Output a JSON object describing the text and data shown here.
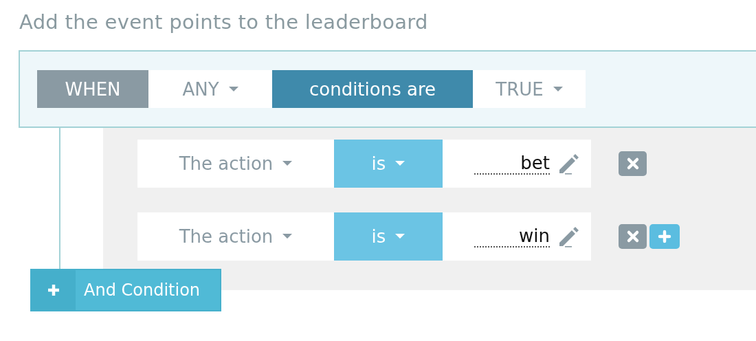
{
  "title": "Add the event points to the leaderboard",
  "when": {
    "label": "WHEN",
    "quantifier": "ANY",
    "middle": "conditions are",
    "truth": "TRUE"
  },
  "conditions": [
    {
      "field": "The action",
      "operator": "is",
      "value": "bet",
      "can_add": false
    },
    {
      "field": "The action",
      "operator": "is",
      "value": "win",
      "can_add": true
    }
  ],
  "add_button": {
    "label": "And Condition"
  }
}
